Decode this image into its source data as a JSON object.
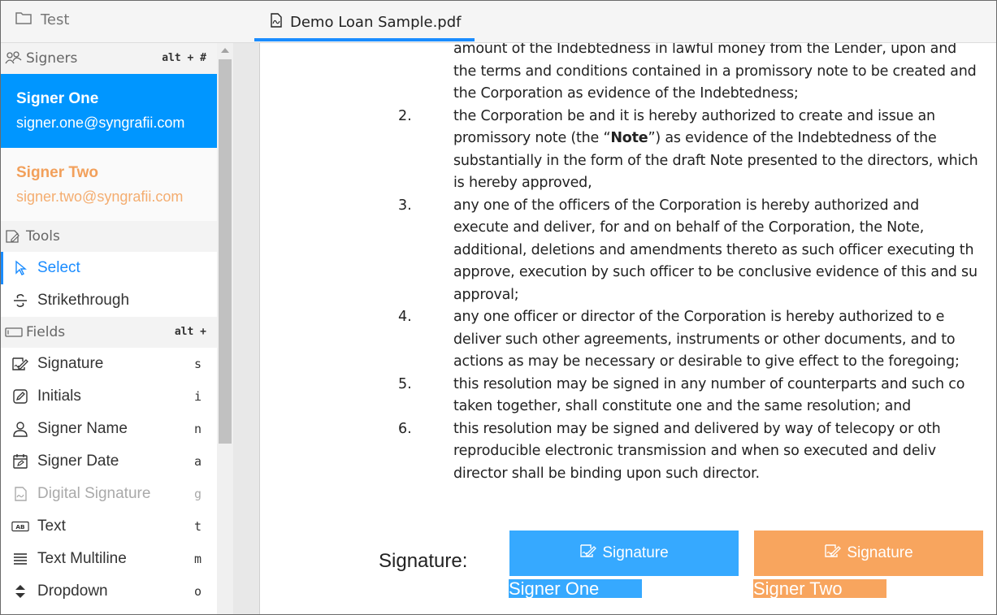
{
  "tabs": {
    "folder_label": "Test",
    "document_label": "Demo Loan Sample.pdf"
  },
  "sidebar": {
    "signers_header": {
      "label": "Signers",
      "shortcut": "alt + #"
    },
    "signers": [
      {
        "name": "Signer One",
        "email": "signer.one@syngrafii.com",
        "color": "#0096ff"
      },
      {
        "name": "Signer Two",
        "email": "signer.two@syngrafii.com",
        "color": "#f2a05b"
      }
    ],
    "tools_header": {
      "label": "Tools"
    },
    "tools": [
      {
        "label": "Select",
        "icon": "cursor-icon"
      },
      {
        "label": "Strikethrough",
        "icon": "strikethrough-icon"
      }
    ],
    "fields_header": {
      "label": "Fields",
      "shortcut": "alt +"
    },
    "fields": [
      {
        "label": "Signature",
        "key": "s",
        "icon": "signature-icon"
      },
      {
        "label": "Initials",
        "key": "i",
        "icon": "pen-box-icon"
      },
      {
        "label": "Signer Name",
        "key": "n",
        "icon": "person-icon"
      },
      {
        "label": "Signer Date",
        "key": "a",
        "icon": "calendar-icon"
      },
      {
        "label": "Digital Signature",
        "key": "g",
        "icon": "digital-signature-icon"
      },
      {
        "label": "Text",
        "key": "t",
        "icon": "text-box-icon"
      },
      {
        "label": "Text Multiline",
        "key": "m",
        "icon": "lines-icon"
      },
      {
        "label": "Dropdown",
        "key": "o",
        "icon": "dropdown-icon"
      }
    ]
  },
  "document": {
    "lines": [
      {
        "num": "",
        "text": "amount of the Indebtedness in lawful money from the Lender, upon and"
      },
      {
        "num": "",
        "text": "the terms and conditions contained in a promissory note to be created and"
      },
      {
        "num": "",
        "text": "the Corporation as evidence of the Indebtedness;"
      },
      {
        "num": "2.",
        "text": "the Corporation be and it is hereby authorized to create and issue an"
      },
      {
        "num": "",
        "text_before": "promissory note (the “",
        "bold": "Note",
        "text_after": "”) as evidence of the Indebtedness of the"
      },
      {
        "num": "",
        "text": "substantially in the form of the draft Note presented to the directors, which"
      },
      {
        "num": "",
        "text": "is hereby approved,"
      },
      {
        "num": "3.",
        "text": "any one of the officers of the Corporation is hereby authorized and"
      },
      {
        "num": "",
        "text": "execute and deliver, for and on behalf of the Corporation, the Note,"
      },
      {
        "num": "",
        "text": "additional, deletions and amendments thereto as such officer executing th"
      },
      {
        "num": "",
        "text": "approve, execution by such officer to be conclusive evidence of this and su"
      },
      {
        "num": "",
        "text": "approval;"
      },
      {
        "num": "4.",
        "text": "any one officer or director of the Corporation is hereby authorized to e"
      },
      {
        "num": "",
        "text": "deliver such other agreements, instruments or other documents, and to"
      },
      {
        "num": "",
        "text": "actions as may be necessary or desirable to give effect to the foregoing;"
      },
      {
        "num": "5.",
        "text": "this resolution may be signed in any number of counterparts and such co"
      },
      {
        "num": "",
        "text": "taken together, shall constitute one and the same resolution; and"
      },
      {
        "num": "6.",
        "text": "this resolution may be signed and delivered by way of telecopy or oth"
      },
      {
        "num": "",
        "text": "reproducible electronic transmission and when so executed and deliv"
      },
      {
        "num": "",
        "text": "director shall be binding upon such director."
      }
    ],
    "signature_label": "Signature:",
    "signature_fields": [
      {
        "label": "Signature",
        "signer": "Signer One",
        "color": "#36a9ff"
      },
      {
        "label": "Signature",
        "signer": "Signer Two",
        "color": "#f8a55e"
      }
    ]
  }
}
